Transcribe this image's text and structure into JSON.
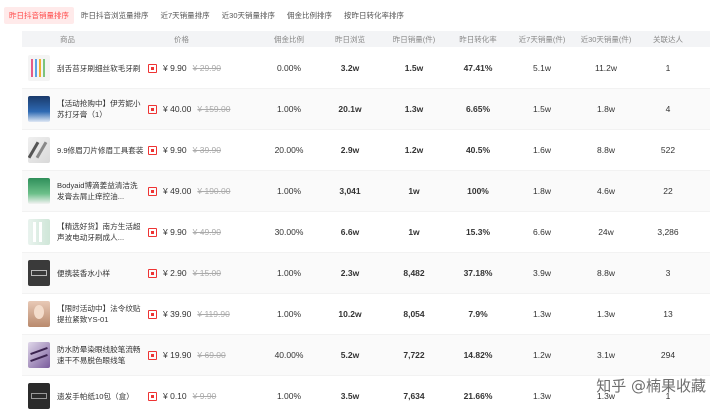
{
  "tabs": [
    {
      "label": "昨日抖音销量排序",
      "active": true
    },
    {
      "label": "昨日抖音浏览量排序",
      "active": false
    },
    {
      "label": "近7天销量排序",
      "active": false
    },
    {
      "label": "近30天销量排序",
      "active": false
    },
    {
      "label": "佣金比例排序",
      "active": false
    },
    {
      "label": "按昨日转化率排序",
      "active": false
    }
  ],
  "columns": [
    "商品",
    "价格",
    "佣金比例",
    "昨日浏览",
    "昨日销量(件)",
    "昨日转化率",
    "近7天销量(件)",
    "近30天销量(件)",
    "关联达人"
  ],
  "rows": [
    {
      "name": "刮舌苔牙刷细丝软毛牙刷",
      "price": "¥ 9.90",
      "old_price": "¥ 29.90",
      "commission": "0.00%",
      "views": "3.2w",
      "sales": "1.5w",
      "conversion": "47.41%",
      "sales7": "5.1w",
      "sales30": "11.2w",
      "related": "1",
      "thumb": "brushes"
    },
    {
      "name": "【活动抢购中】伊芳妮小苏打牙膏（1）",
      "price": "¥ 40.00",
      "old_price": "¥ 159.00",
      "commission": "1.00%",
      "views": "20.1w",
      "sales": "1.3w",
      "conversion": "6.65%",
      "sales7": "1.5w",
      "sales30": "1.8w",
      "related": "4",
      "thumb": "toothpaste"
    },
    {
      "name": "9.9修眉刀片修眉工具套装",
      "price": "¥ 9.90",
      "old_price": "¥ 39.90",
      "commission": "20.00%",
      "views": "2.9w",
      "sales": "1.2w",
      "conversion": "40.5%",
      "sales7": "1.6w",
      "sales30": "8.8w",
      "related": "522",
      "thumb": "razor"
    },
    {
      "name": "Bodyaid博滴姜益清洁洗发膏去屑止痒控油...",
      "price": "¥ 49.00",
      "old_price": "¥ 190.00",
      "commission": "1.00%",
      "views": "3,041",
      "sales": "1w",
      "conversion": "100%",
      "sales7": "1.8w",
      "sales30": "4.6w",
      "related": "22",
      "thumb": "shampoo"
    },
    {
      "name": "【精选好货】南方生活超声波电动牙刷成人...",
      "price": "¥ 9.90",
      "old_price": "¥ 49.90",
      "commission": "30.00%",
      "views": "6.6w",
      "sales": "1w",
      "conversion": "15.3%",
      "sales7": "6.6w",
      "sales30": "24w",
      "related": "3,286",
      "thumb": "ebrush"
    },
    {
      "name": "便携装香水小样",
      "price": "¥ 2.90",
      "old_price": "¥ 15.00",
      "commission": "1.00%",
      "views": "2.3w",
      "sales": "8,482",
      "conversion": "37.18%",
      "sales7": "3.9w",
      "sales30": "8.8w",
      "related": "3",
      "thumb": "perfume"
    },
    {
      "name": "【限时活动中】法令纹贴提拉紧致YS-01",
      "price": "¥ 39.90",
      "old_price": "¥ 119.90",
      "commission": "1.00%",
      "views": "10.2w",
      "sales": "8,054",
      "conversion": "7.9%",
      "sales7": "1.3w",
      "sales30": "1.3w",
      "related": "13",
      "thumb": "face"
    },
    {
      "name": "防水防晕染眼线胶笔流畅速干不易脱色眼线笔",
      "price": "¥ 19.90",
      "old_price": "¥ 69.00",
      "commission": "40.00%",
      "views": "5.2w",
      "sales": "7,722",
      "conversion": "14.82%",
      "sales7": "1.2w",
      "sales30": "3.1w",
      "related": "294",
      "thumb": "eyeliner"
    },
    {
      "name": "遗发手帕纸10包（盒）",
      "price": "¥ 0.10",
      "old_price": "¥ 9.90",
      "commission": "1.00%",
      "views": "3.5w",
      "sales": "7,634",
      "conversion": "21.66%",
      "sales7": "1.3w",
      "sales30": "1.3w",
      "related": "1",
      "thumb": "tissue"
    }
  ],
  "watermark": "知乎 @楠果收藏"
}
